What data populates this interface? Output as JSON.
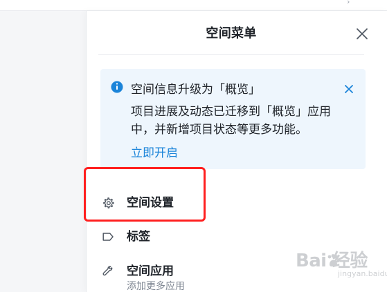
{
  "drawer": {
    "title": "空间菜单"
  },
  "notice": {
    "title": "空间信息升级为「概览」",
    "body": "项目进展及动态已迁移到「概览」应用中，并新增项目状态等更多功能。",
    "link": "立即开启"
  },
  "menu": {
    "items": [
      {
        "label": "空间设置",
        "icon": "gear-icon"
      },
      {
        "label": "标签",
        "icon": "tag-icon"
      },
      {
        "label": "空间应用",
        "subtitle": "添加更多应用",
        "icon": "wrench-icon"
      }
    ]
  },
  "watermark": {
    "main": "Bai  经验",
    "sub": "jingyan.baidu.com"
  },
  "colors": {
    "accent": "#1b84d9",
    "notice_background": "#eef6fd",
    "highlight": "#ff1f1f"
  }
}
